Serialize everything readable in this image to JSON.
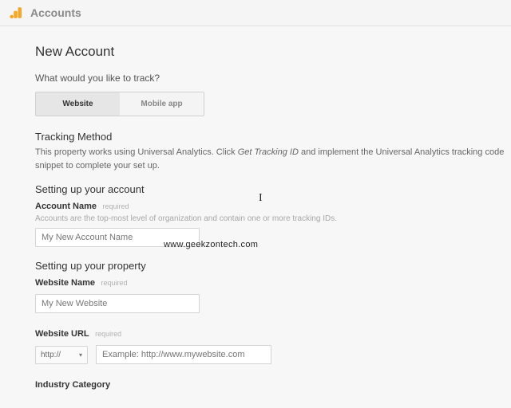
{
  "header": {
    "title": "Accounts"
  },
  "page": {
    "title": "New Account"
  },
  "question": "What would you like to track?",
  "toggle": {
    "website": "Website",
    "mobile": "Mobile app"
  },
  "tracking": {
    "title": "Tracking Method",
    "help_before": "This property works using Universal Analytics. Click ",
    "help_italic": "Get Tracking ID",
    "help_after": " and implement the Universal Analytics tracking code snippet to complete your set up."
  },
  "account": {
    "section": "Setting up your account",
    "name_label": "Account Name",
    "name_req": "required",
    "name_hint": "Accounts are the top-most level of organization and contain one or more tracking IDs.",
    "name_value": "My New Account Name"
  },
  "property": {
    "section": "Setting up your property",
    "site_name_label": "Website Name",
    "site_name_req": "required",
    "site_name_value": "My New Website",
    "url_label": "Website URL",
    "url_req": "required",
    "protocol": "http://",
    "url_placeholder": "Example: http://www.mywebsite.com",
    "category_label": "Industry Category"
  },
  "watermark": "www.geekzontech.com"
}
